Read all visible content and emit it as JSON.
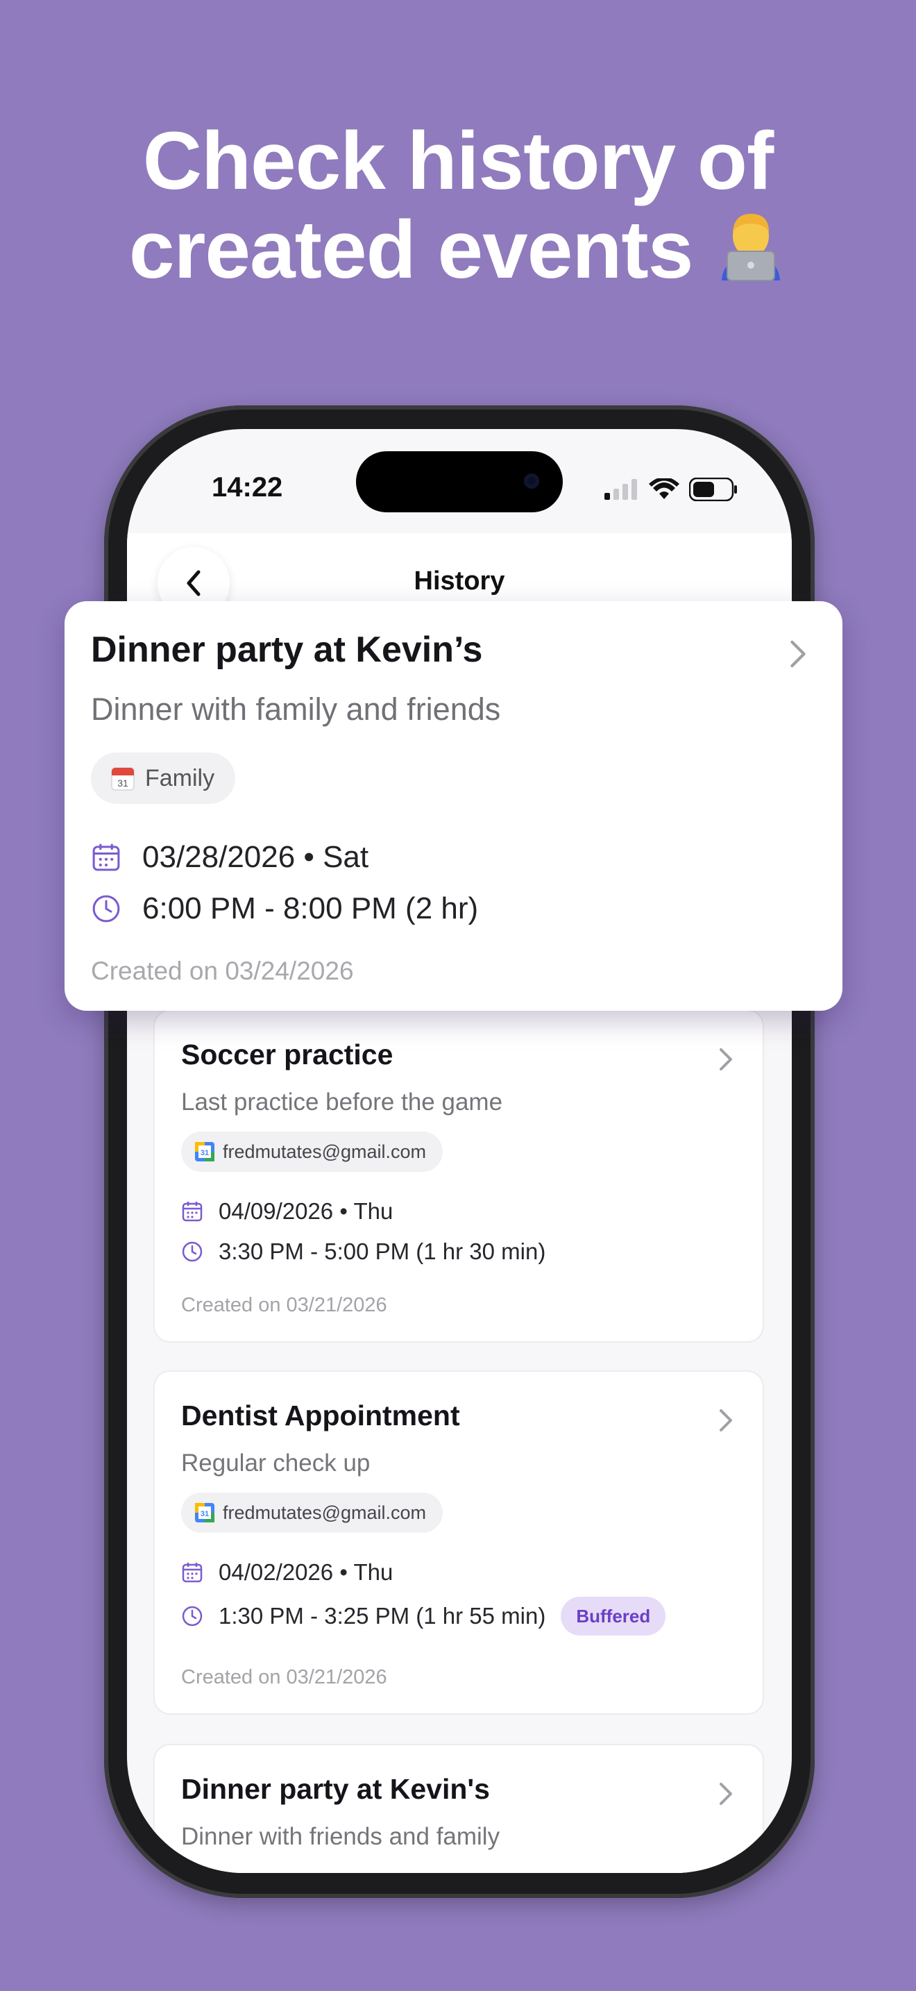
{
  "headline": {
    "line1": "Check history of",
    "line2": "created events"
  },
  "status_bar": {
    "time": "14:22"
  },
  "nav": {
    "title": "History",
    "back_icon": "chevron-left-icon"
  },
  "featured": {
    "title": "Dinner party at Kevin’s",
    "description": "Dinner with family and friends",
    "calendar": "Family",
    "date": "03/28/2026 • Sat",
    "time": "6:00 PM - 8:00 PM (2 hr)",
    "created": "Created on 03/24/2026"
  },
  "events": [
    {
      "title": "Soccer practice",
      "description": "Last practice before the game",
      "calendar": "fredmutates@gmail.com",
      "date": "04/09/2026 • Thu",
      "time": "3:30 PM - 5:00 PM (1 hr 30 min)",
      "created": "Created on 03/21/2026"
    },
    {
      "title": "Dentist Appointment",
      "description": "Regular check up",
      "calendar": "fredmutates@gmail.com",
      "date": "04/02/2026 • Thu",
      "time": "1:30 PM - 3:25 PM (1 hr 55 min)",
      "badge": "Buffered",
      "created": "Created on 03/21/2026"
    },
    {
      "title": "Dinner party at Kevin's",
      "description": "Dinner with friends and family"
    }
  ],
  "colors": {
    "background": "#8f7bbd",
    "accent": "#7a5bd0",
    "badge_bg": "#e6dcf8",
    "badge_text": "#6b3fc6"
  }
}
